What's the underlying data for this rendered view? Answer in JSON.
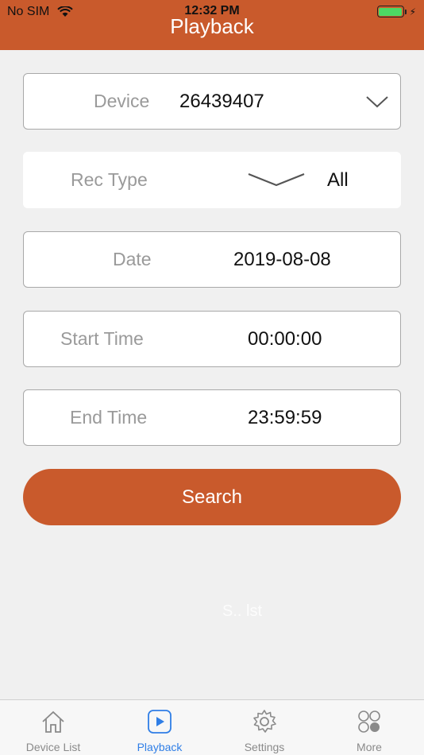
{
  "status": {
    "carrier": "No SIM",
    "time": "12:32 PM",
    "battery_color": "#4cd964"
  },
  "header": {
    "title": "Playback",
    "bg_color": "#c95a2c"
  },
  "form": {
    "device": {
      "label": "Device",
      "value": "26439407"
    },
    "rec_type": {
      "label": "Rec Type",
      "value": "All"
    },
    "date": {
      "label": "Date",
      "value": "2019-08-08"
    },
    "start_time": {
      "label": "Start Time",
      "value": "00:00:00"
    },
    "end_time": {
      "label": "End Time",
      "value": "23:59:59"
    }
  },
  "search_button": {
    "label": "Search",
    "color": "#c95a2c"
  },
  "faint_text": "S.. lst",
  "tabs": [
    {
      "label": "Device List",
      "icon": "home-icon",
      "active": false
    },
    {
      "label": "Playback",
      "icon": "play-icon",
      "active": true
    },
    {
      "label": "Settings",
      "icon": "gear-icon",
      "active": false
    },
    {
      "label": "More",
      "icon": "more-icon",
      "active": false
    }
  ],
  "accent_active": "#2f7ee6"
}
